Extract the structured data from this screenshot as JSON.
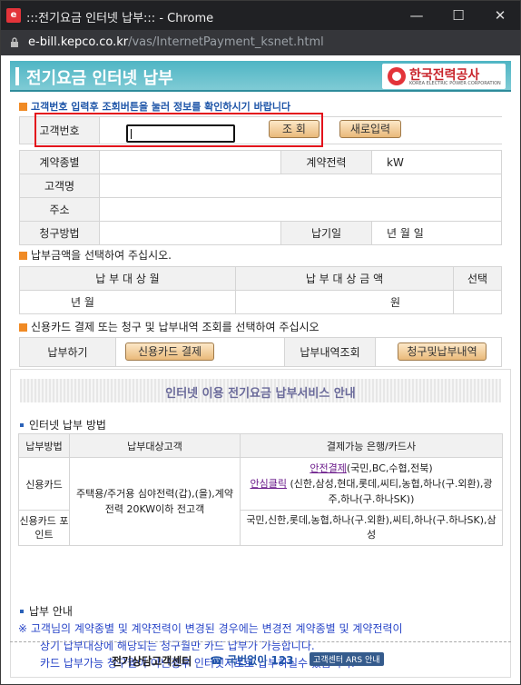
{
  "window": {
    "title": ":::전기요금 인터넷 납부::: - Chrome",
    "url_host": "e-bill.kepco.co.kr",
    "url_path": "/vas/InternetPayment_ksnet.html",
    "min": "—",
    "max": "☐",
    "close": "✕"
  },
  "header": {
    "title": "전기요금 인터넷 납부",
    "logo_name": "한국전력공사",
    "logo_en": "KOREA ELECTRIC POWER CORPORATION"
  },
  "notice": "고객번호 입력후 조회버튼을 눌러 정보를 확인하시기 바랍니다",
  "lookup": {
    "customer_no_label": "고객번호",
    "customer_no_value": "",
    "search_button": "조 회",
    "reset_button": "새로입력"
  },
  "info": {
    "contract_type_label": "계약종별",
    "contract_type_value": "",
    "contract_power_label": "계약전력",
    "contract_power_unit": "kW",
    "customer_name_label": "고객명",
    "customer_name_value": "",
    "address_label": "주소",
    "address_value": "",
    "billing_method_label": "청구방법",
    "billing_method_value": "",
    "due_date_label": "납기일",
    "due_date_value": "년 월 일"
  },
  "amount_section": {
    "title": "납부금액을 선택하여 주십시오.",
    "col_month": "납 부 대 상 월",
    "col_amount": "납 부 대 상 금 액",
    "col_select": "선택",
    "row_month": "년 월",
    "row_amount": "원"
  },
  "pay_section": {
    "title": "신용카드 결제 또는 청구 및 납부내역 조회를 선택하여 주십시오",
    "pay_label": "납부하기",
    "card_button": "신용카드 결제",
    "history_label": "납부내역조회",
    "history_button": "청구및납부내역"
  },
  "guide": {
    "header": "인터넷 이용 전기요금 납부서비스 안내",
    "method_title": "인터넷 납부 방법",
    "col_method": "납부방법",
    "col_target": "납부대상고객",
    "col_bank": "결제가능 은행/카드사",
    "row1_method": "신용카드",
    "target": "주택용/주거용 심야전력(갑),(을),계약전력 20KW이하 전고객",
    "row1_link1": "안전결제",
    "row1_text1": "(국민,BC,수협,전북)",
    "row1_link2": "안심클릭",
    "row1_text2": " (신한,삼성,현대,롯데,씨티,농협,하나(구.외환),광주,하나(구.하나SK))",
    "row2_method": "신용카드 포인트",
    "row2_banks": "국민,신한,롯데,농협,하나(구.외환),씨티,하나(구.하나SK),삼성",
    "notice_title": "납부 안내",
    "notice_line1": "※ 고객님의 계약종별 및 계약전력이 변경된 경우에는 변경전 계약종별 및 계약전력이",
    "notice_line2": "상기 납부대상에 해당되는 청구월만 카드 납부가 가능합니다.",
    "notice_line3": "카드 납부가능 청구월이 아닌경우 인터넷지로로 납부하실수 있습니다."
  },
  "footer": {
    "center": "전기상담고객센터",
    "phone": "☎ 국번없이 123",
    "ars": "고객센터 ARS 안내"
  }
}
